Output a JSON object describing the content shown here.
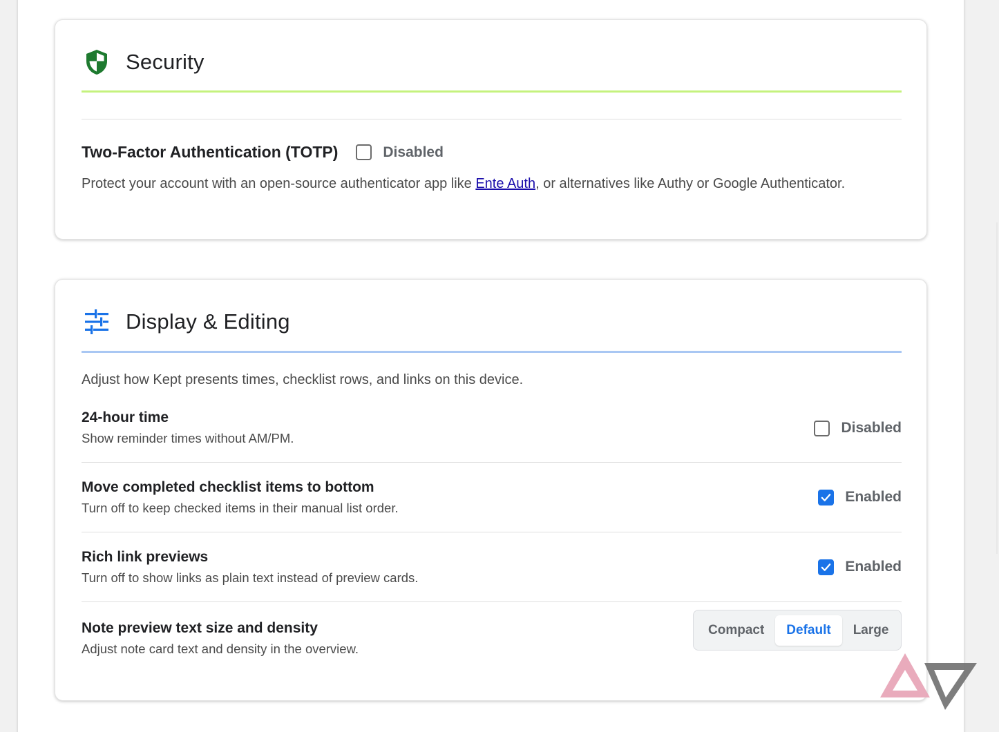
{
  "security": {
    "title": "Security",
    "icon": "shield-icon",
    "accent_color": "#c5f27e",
    "tfa": {
      "label": "Two-Factor Authentication (TOTP)",
      "checked": false,
      "status": "Disabled",
      "desc_before": "Protect your account with an open-source authenticator app like ",
      "link_text": "Ente Auth",
      "desc_after": ", or alternatives like Authy or Google Authenticator."
    }
  },
  "display": {
    "title": "Display & Editing",
    "icon": "tune-sliders-icon",
    "accent_color": "#a9c7f3",
    "intro": "Adjust how Kept presents times, checklist rows, and links on this device.",
    "settings": [
      {
        "title": "24-hour time",
        "subtitle": "Show reminder times without AM/PM.",
        "checked": false,
        "status": "Disabled"
      },
      {
        "title": "Move completed checklist items to bottom",
        "subtitle": "Turn off to keep checked items in their manual list order.",
        "checked": true,
        "status": "Enabled"
      },
      {
        "title": "Rich link previews",
        "subtitle": "Turn off to show links as plain text instead of preview cards.",
        "checked": true,
        "status": "Enabled"
      }
    ],
    "density": {
      "title": "Note preview text size and density",
      "subtitle": "Adjust note card text and density in the overview.",
      "options": [
        "Compact",
        "Default",
        "Large"
      ],
      "selected": "Default"
    }
  },
  "colors": {
    "checkbox_checked": "#1a73e8",
    "link": "#1a0dab"
  }
}
